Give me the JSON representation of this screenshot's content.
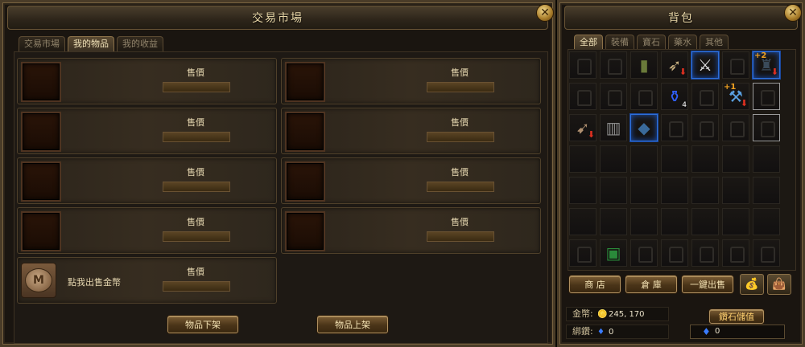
{
  "market": {
    "title": "交易市場",
    "tabs": [
      "交易市場",
      "我的物品",
      "我的收益"
    ],
    "active_tab": 1,
    "slot_price_label": "售價",
    "coin_slot_text": "點我出售金幣",
    "coin_icon": "M",
    "buttons": {
      "unlist": "物品下架",
      "list": "物品上架"
    }
  },
  "bag": {
    "title": "背包",
    "tabs": [
      "全部",
      "裝備",
      "寶石",
      "藥水",
      "其他"
    ],
    "active_tab": 0,
    "items": {
      "2": {
        "icon": "green-pants-icon",
        "glyph": "▮",
        "color": "#6a7a3a"
      },
      "3": {
        "icon": "bow-icon",
        "glyph": "➶",
        "color": "#c8b080",
        "down": true
      },
      "4": {
        "icon": "sword-icon",
        "glyph": "⚔",
        "color": "#e8e8e8",
        "sel": true
      },
      "6": {
        "icon": "dark-armor-icon",
        "glyph": "♜",
        "color": "#3a4a5a",
        "enh": "+2",
        "sel": true,
        "down": true
      },
      "10": {
        "icon": "blue-potion-icon",
        "glyph": "⚱",
        "color": "#3060ff",
        "qty": "4"
      },
      "12": {
        "icon": "blue-blades-icon",
        "glyph": "⚒",
        "color": "#5aa0e0",
        "enh": "+1",
        "down": true
      },
      "13": {
        "hl": true
      },
      "14": {
        "icon": "crossbow-icon",
        "glyph": "➹",
        "color": "#b09070",
        "down": true
      },
      "15": {
        "icon": "leg-armor-icon",
        "glyph": "▥",
        "color": "#8a8a8a"
      },
      "16": {
        "icon": "blue-cloak-icon",
        "glyph": "◆",
        "color": "#3a6a9a",
        "sel": true
      },
      "20": {
        "hl": true
      },
      "43": {
        "icon": "green-bag-icon",
        "glyph": "▣",
        "color": "#2a8a3a"
      }
    },
    "locked_cells": [
      0,
      1,
      5,
      7,
      8,
      9,
      11,
      13,
      17,
      18,
      19,
      20,
      42,
      44,
      45,
      46,
      47,
      48
    ],
    "buttons": {
      "shop": "商 店",
      "warehouse": "倉 庫",
      "sell_all": "一鍵出售",
      "diamond_store": "鑽石儲值"
    },
    "currency": {
      "gold_label": "金幣:",
      "gold_value": "245, 170",
      "bound_label": "綁鑽:",
      "bound_value": "0",
      "diamond_value": "0"
    }
  }
}
